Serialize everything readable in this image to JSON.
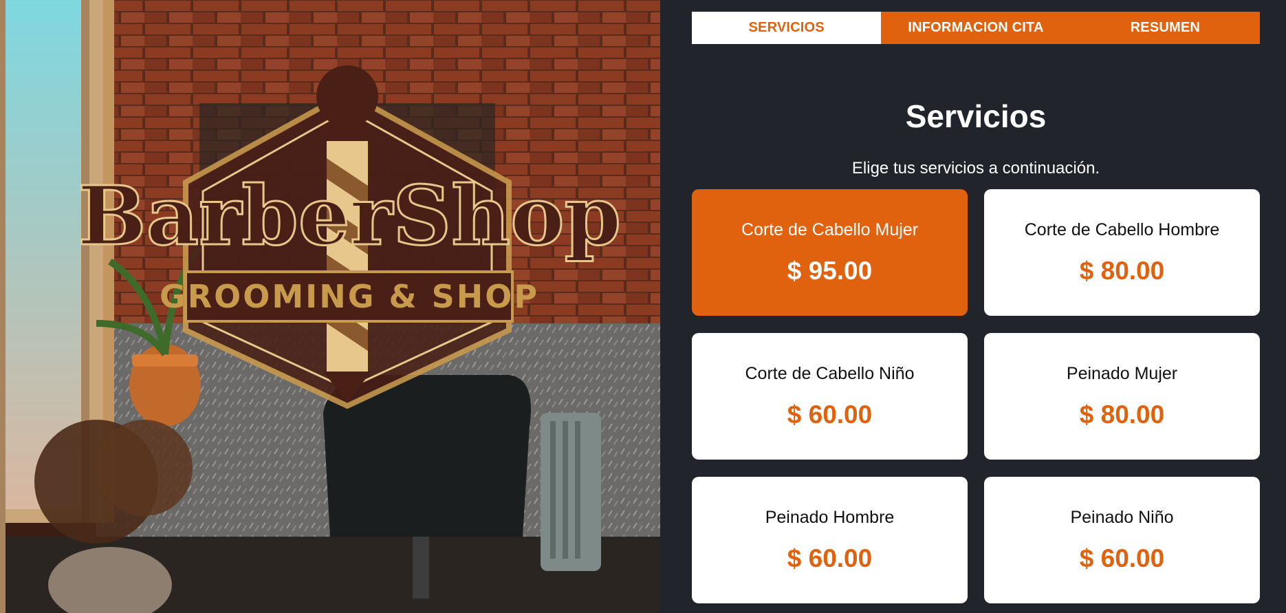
{
  "hero": {
    "logo_top": "BarberShop",
    "logo_banner": "GROOMING & SHOP"
  },
  "tabs": [
    {
      "label": "SERVICIOS",
      "active": true
    },
    {
      "label": "INFORMACION CITA",
      "active": false
    },
    {
      "label": "RESUMEN",
      "active": false
    }
  ],
  "section": {
    "title": "Servicios",
    "subtitle": "Elige tus servicios a continuación."
  },
  "services": [
    {
      "name": "Corte de Cabello Mujer",
      "price": "$ 95.00",
      "selected": true
    },
    {
      "name": "Corte de Cabello Hombre",
      "price": "$ 80.00",
      "selected": false
    },
    {
      "name": "Corte de Cabello Niño",
      "price": "$ 60.00",
      "selected": false
    },
    {
      "name": "Peinado Mujer",
      "price": "$ 80.00",
      "selected": false
    },
    {
      "name": "Peinado Hombre",
      "price": "$ 60.00",
      "selected": false
    },
    {
      "name": "Peinado Niño",
      "price": "$ 60.00",
      "selected": false
    }
  ],
  "colors": {
    "accent": "#e0620e",
    "background": "#21242a",
    "card": "#ffffff",
    "logo_brown": "#4a1f16",
    "logo_gold": "#c89a4c"
  }
}
